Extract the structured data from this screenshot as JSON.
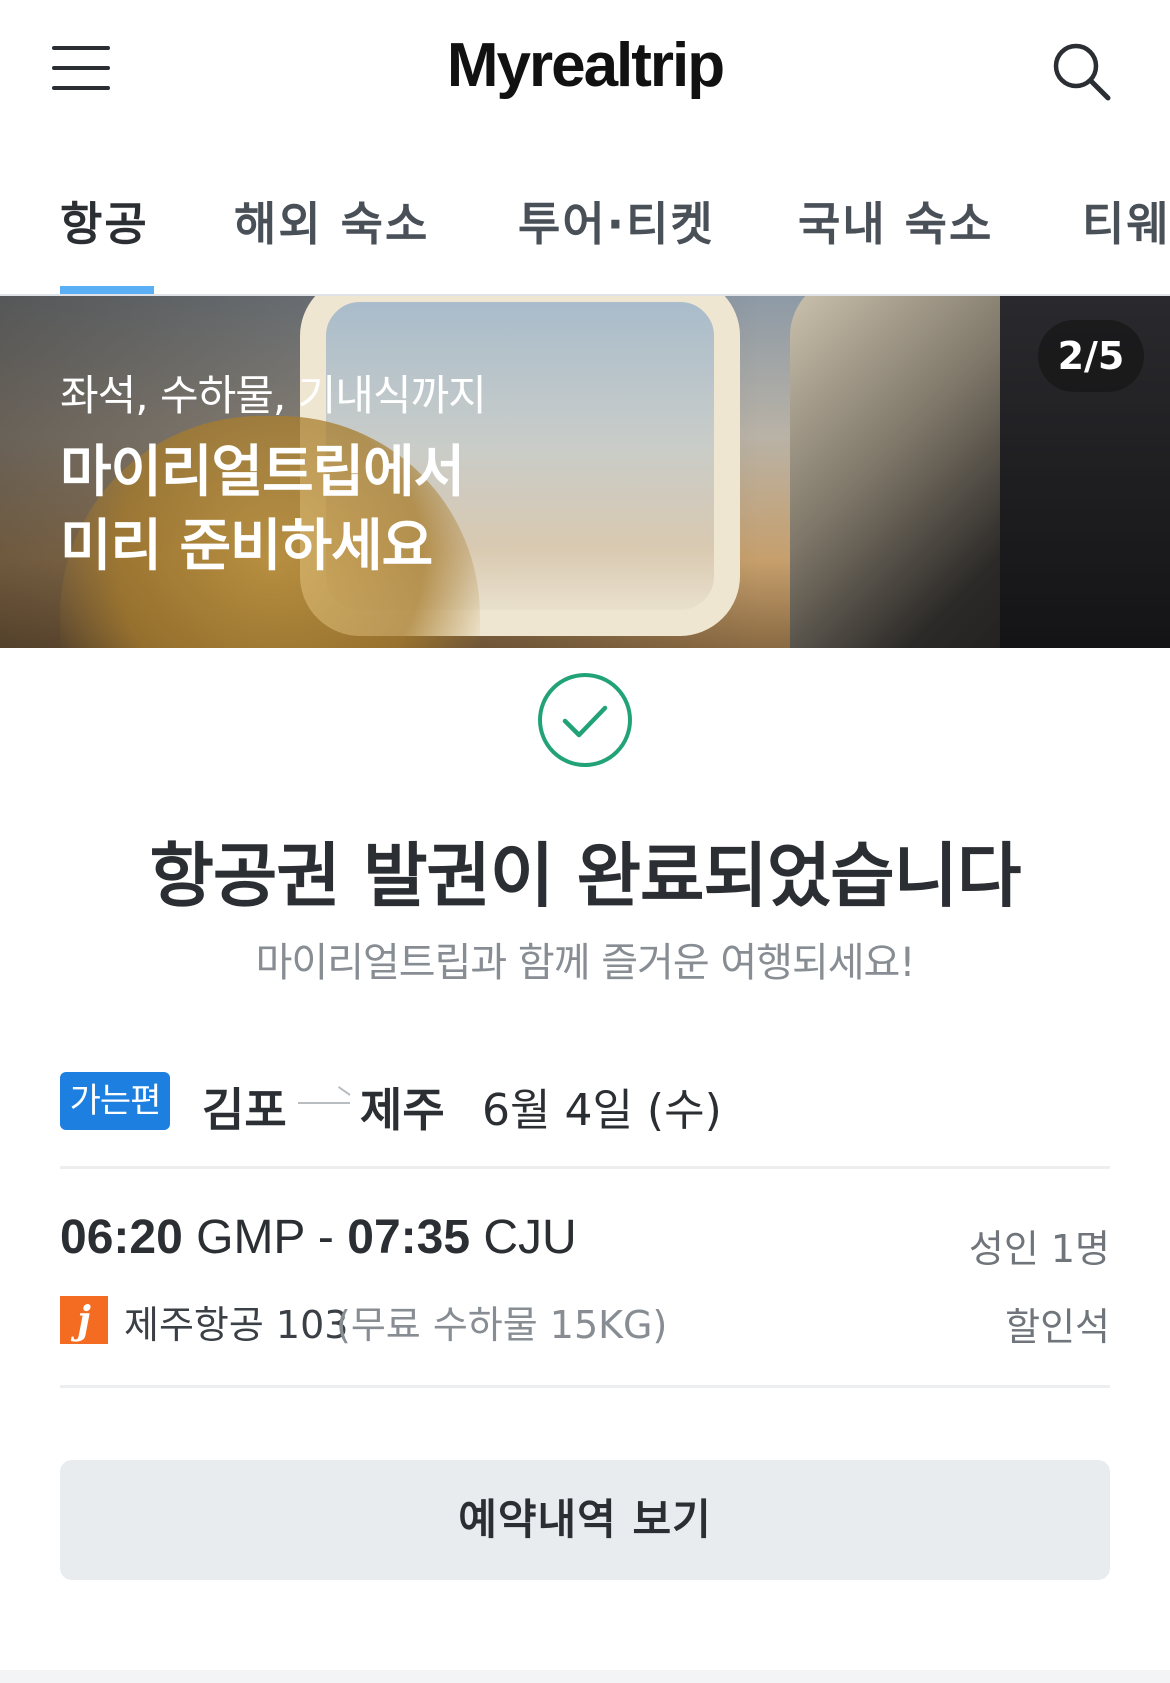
{
  "header": {
    "logo": "Myrealtrip",
    "menu_icon": "hamburger-menu-icon",
    "search_icon": "search-icon"
  },
  "tabs": [
    {
      "label": "항공",
      "active": true
    },
    {
      "label": "해외 숙소",
      "active": false
    },
    {
      "label": "투어·티켓",
      "active": false
    },
    {
      "label": "국내 숙소",
      "active": false
    },
    {
      "label": "티웨",
      "active": false
    }
  ],
  "banner": {
    "subtitle": "좌석, 수하물, 기내식까지",
    "title_line1": "마이리얼트립에서",
    "title_line2": "미리 준비하세요",
    "counter": "2/5"
  },
  "confirmation": {
    "icon": "check-circle-icon",
    "title": "항공권 발권이 완료되었습니다",
    "subtitle": "마이리얼트립과 함께 즐거운 여행되세요!"
  },
  "flight": {
    "badge": "가는편",
    "from": "김포",
    "to": "제주",
    "date": "6월 4일 (수)",
    "depart_time": "06:20",
    "depart_code": "GMP",
    "separator": "-",
    "arrive_time": "07:35",
    "arrive_code": "CJU",
    "passengers": "성인 1명",
    "airline_logo_letter": "j",
    "airline": "제주항공 103",
    "baggage": "(무료 수하물 15KG)",
    "seat_class": "할인석"
  },
  "actions": {
    "view_reservation": "예약내역 보기"
  },
  "colors": {
    "accent_blue": "#1d7fe0",
    "tab_indicator": "#5aaff5",
    "success_green": "#22a277",
    "airline_orange": "#f36c21"
  }
}
